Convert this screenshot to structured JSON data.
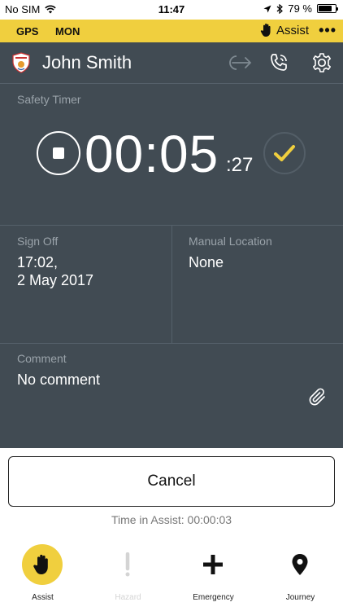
{
  "status_bar": {
    "carrier": "No SIM",
    "time": "11:47",
    "battery": "79 %",
    "battery_level": 0.79
  },
  "info_bar": {
    "gps": "GPS",
    "mon": "MON",
    "assist": "Assist",
    "more": "•••"
  },
  "header": {
    "user_name": "John Smith"
  },
  "safety_timer": {
    "label": "Safety Timer",
    "time_main": "00:05",
    "time_sub": ":27"
  },
  "sign_off": {
    "label": "Sign Off",
    "time_line1": "17:02,",
    "time_line2": "2 May 2017"
  },
  "manual_location": {
    "label": "Manual Location",
    "value": "None"
  },
  "comment": {
    "label": "Comment",
    "value": "No comment"
  },
  "cancel_label": "Cancel",
  "assist_time_text": "Time in Assist: 00:00:03",
  "tabs": [
    {
      "label": "Assist",
      "icon": "hand-icon"
    },
    {
      "label": "Hazard",
      "icon": "exclamation-icon"
    },
    {
      "label": "Emergency",
      "icon": "plus-icon"
    },
    {
      "label": "Journey",
      "icon": "location-pin-icon"
    }
  ],
  "colors": {
    "accent_yellow": "#f0cf3e",
    "panel_dark": "#414b53"
  }
}
